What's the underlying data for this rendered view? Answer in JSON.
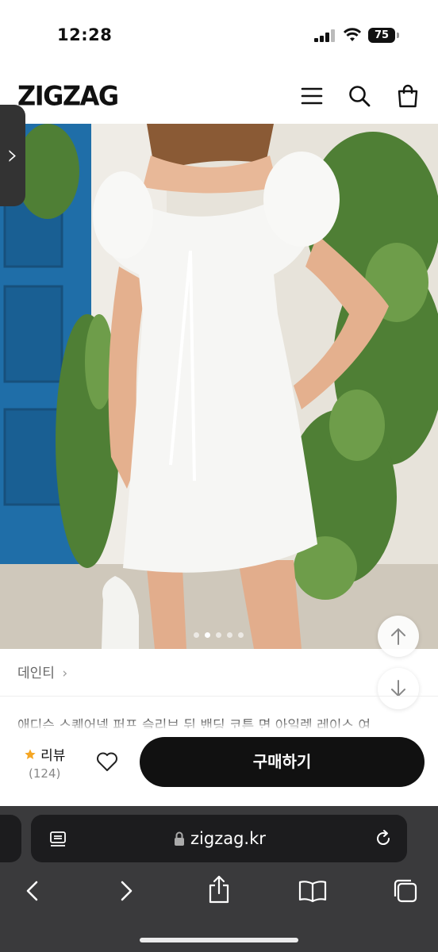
{
  "status_bar": {
    "time": "12:28",
    "battery": "75"
  },
  "header": {
    "logo": "ZIGZAG"
  },
  "product": {
    "store": "데인티",
    "title": "애디슨 스퀘어넥 퍼프 슬리브 뒤 밴딩 코튼 면 아일렛 레이스 여",
    "image_pages": 5,
    "image_current": 1
  },
  "review": {
    "label": "리뷰",
    "count": "(124)"
  },
  "buy": {
    "label": "구매하기"
  },
  "browser": {
    "url": "zigzag.kr"
  },
  "colors": {
    "button": "#111111",
    "browser_bar": "#3a3a3c",
    "star": "#f5a623"
  }
}
